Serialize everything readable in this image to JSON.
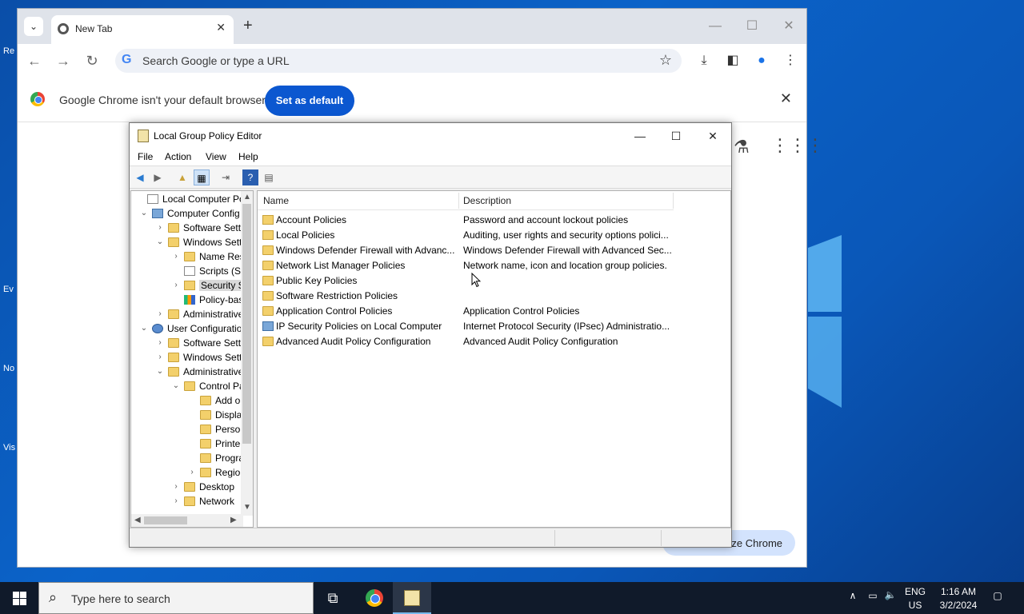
{
  "desktop": {
    "icon_labels": [
      "Re",
      "Ev",
      "No",
      "Vis"
    ]
  },
  "chrome": {
    "tab_title": "New Tab",
    "omnibox_placeholder": "Search Google or type a URL",
    "infobar_text": "Google Chrome isn't your default browser",
    "set_default_label": "Set as default",
    "customize_label": "ze Chrome"
  },
  "gpe": {
    "title": "Local Group Policy Editor",
    "menu": [
      "File",
      "Action",
      "View",
      "Help"
    ],
    "tree": [
      {
        "label": "Local Computer Polic",
        "icon": "document-icon",
        "arrow": ""
      },
      {
        "label": "Computer Config",
        "icon": "computer-icon",
        "arrow": "expanded"
      },
      {
        "label": "Software Setti",
        "icon": "folder-icon",
        "arrow": "collapsed"
      },
      {
        "label": "Windows Sett",
        "icon": "folder-icon",
        "arrow": "expanded"
      },
      {
        "label": "Name Res",
        "icon": "folder-icon",
        "arrow": "collapsed"
      },
      {
        "label": "Scripts (Sta",
        "icon": "script-icon",
        "arrow": ""
      },
      {
        "label": "Security Se",
        "icon": "security-icon",
        "arrow": "collapsed",
        "selected": true
      },
      {
        "label": "Policy-bas",
        "icon": "chart-icon",
        "arrow": ""
      },
      {
        "label": "Administrative",
        "icon": "folder-icon",
        "arrow": "collapsed"
      },
      {
        "label": "User Configuratio",
        "icon": "user-icon",
        "arrow": "expanded"
      },
      {
        "label": "Software Setti",
        "icon": "folder-icon",
        "arrow": "collapsed"
      },
      {
        "label": "Windows Sett",
        "icon": "folder-icon",
        "arrow": "collapsed"
      },
      {
        "label": "Administrative",
        "icon": "folder-icon",
        "arrow": "expanded"
      },
      {
        "label": "Control Pa",
        "icon": "folder-icon",
        "arrow": "expanded"
      },
      {
        "label": "Add or",
        "icon": "folder-icon",
        "arrow": ""
      },
      {
        "label": "Display",
        "icon": "folder-icon",
        "arrow": ""
      },
      {
        "label": "Person",
        "icon": "folder-icon",
        "arrow": ""
      },
      {
        "label": "Printer",
        "icon": "folder-icon",
        "arrow": ""
      },
      {
        "label": "Progra",
        "icon": "folder-icon",
        "arrow": ""
      },
      {
        "label": "Region",
        "icon": "folder-icon",
        "arrow": "collapsed"
      },
      {
        "label": "Desktop",
        "icon": "folder-icon",
        "arrow": "collapsed"
      },
      {
        "label": "Network",
        "icon": "folder-icon",
        "arrow": "collapsed"
      }
    ],
    "columns": {
      "name": "Name",
      "description": "Description"
    },
    "rows": [
      {
        "name": "Account Policies",
        "description": "Password and account lockout policies",
        "icon": "lock-folder-icon"
      },
      {
        "name": "Local Policies",
        "description": "Auditing, user rights and security options polici...",
        "icon": "lock-folder-icon"
      },
      {
        "name": "Windows Defender Firewall with Advanc...",
        "description": "Windows Defender Firewall with Advanced Sec...",
        "icon": "folder-icon"
      },
      {
        "name": "Network List Manager Policies",
        "description": "Network name, icon and location group policies.",
        "icon": "folder-icon"
      },
      {
        "name": "Public Key Policies",
        "description": "",
        "icon": "folder-icon"
      },
      {
        "name": "Software Restriction Policies",
        "description": "",
        "icon": "folder-icon"
      },
      {
        "name": "Application Control Policies",
        "description": "Application Control Policies",
        "icon": "folder-icon"
      },
      {
        "name": "IP Security Policies on Local Computer",
        "description": "Internet Protocol Security (IPsec) Administratio...",
        "icon": "ipsec-icon"
      },
      {
        "name": "Advanced Audit Policy Configuration",
        "description": "Advanced Audit Policy Configuration",
        "icon": "folder-icon"
      }
    ]
  },
  "taskbar": {
    "search_placeholder": "Type here to search",
    "lang_line1": "ENG",
    "lang_line2": "US",
    "time": "1:16 AM",
    "date": "3/2/2024"
  }
}
